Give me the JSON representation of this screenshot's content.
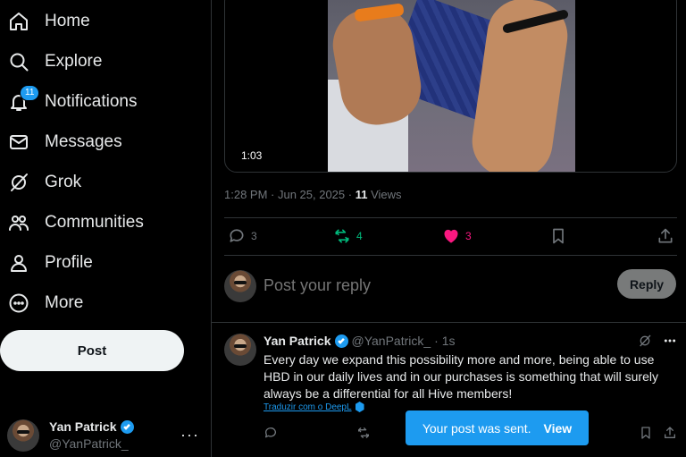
{
  "sidebar": {
    "items": [
      {
        "label": "Home",
        "icon": "home-icon"
      },
      {
        "label": "Explore",
        "icon": "search-icon"
      },
      {
        "label": "Notifications",
        "icon": "bell-icon",
        "badge": "11"
      },
      {
        "label": "Messages",
        "icon": "envelope-icon"
      },
      {
        "label": "Grok",
        "icon": "grok-icon"
      },
      {
        "label": "Communities",
        "icon": "people-icon"
      },
      {
        "label": "Profile",
        "icon": "person-icon"
      },
      {
        "label": "More",
        "icon": "more-circle-icon"
      }
    ],
    "post_label": "Post",
    "account": {
      "name": "Yan Patrick",
      "handle": "@YanPatrick_",
      "more": "···"
    }
  },
  "post": {
    "video_time": "1:03",
    "timestamp": "1:28 PM · Jun 25, 2025 · ",
    "views_count": "11",
    "views_label": " Views",
    "replies": "3",
    "reposts": "4",
    "likes": "3",
    "colors": {
      "repost": "#00ba7c",
      "like": "#f91880",
      "accent": "#1d9bf0"
    }
  },
  "reply_box": {
    "placeholder": "Post your reply",
    "button_label": "Reply"
  },
  "reply_tweet": {
    "name": "Yan Patrick",
    "handle": "@YanPatrick_",
    "time": "· 1s",
    "text": "Every day we expand this possibility more and more, being able to use HBD in our daily lives and in our purchases is something that will surely always be a differential for all Hive members!",
    "translate_label": "Traduzir com o DeepL"
  },
  "toast": {
    "message": "Your post was sent.",
    "action": "View"
  }
}
